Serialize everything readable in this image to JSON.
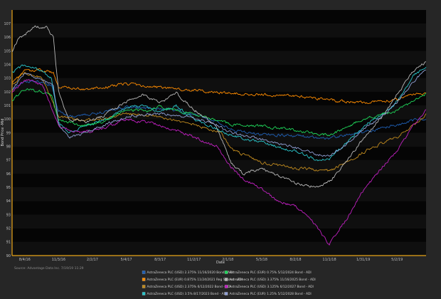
{
  "chart_data": {
    "type": "line",
    "xlabel": "Date",
    "ylabel": "Bond Price -Mid",
    "ylim": [
      90,
      108
    ],
    "yticks": [
      90,
      91,
      92,
      93,
      94,
      95,
      96,
      97,
      98,
      99,
      100,
      101,
      102,
      103,
      104,
      105,
      106,
      107
    ],
    "xticks": [
      "8/4/16",
      "11/3/16",
      "2/2/17",
      "5/4/17",
      "8/3/17",
      "11/2/17",
      "2/1/18",
      "5/3/18",
      "8/2/18",
      "11/1/18",
      "1/31/19",
      "5/2/19"
    ],
    "x_range": [
      "2016-07-01",
      "2019-07-19"
    ],
    "source": "Source: Advantage Data Inc. 7/19/19 11:29",
    "series": [
      {
        "name": "AstraZeneca PLC (USD) 2.375% 11/16/2020 Bond - ADI",
        "color": "#1f5fb4",
        "points": [
          [
            "2016-07-01",
            102.2
          ],
          [
            "2016-08-04",
            102.8
          ],
          [
            "2016-09-15",
            102.7
          ],
          [
            "2016-10-15",
            102.5
          ],
          [
            "2016-11-03",
            100.6
          ],
          [
            "2016-12-01",
            100.2
          ],
          [
            "2017-01-15",
            100.3
          ],
          [
            "2017-03-01",
            100.5
          ],
          [
            "2017-05-04",
            100.9
          ],
          [
            "2017-07-01",
            100.8
          ],
          [
            "2017-09-01",
            100.7
          ],
          [
            "2017-11-02",
            100.3
          ],
          [
            "2018-01-01",
            99.9
          ],
          [
            "2018-02-01",
            99.4
          ],
          [
            "2018-03-15",
            99.0
          ],
          [
            "2018-05-03",
            98.9
          ],
          [
            "2018-08-02",
            98.8
          ],
          [
            "2018-10-01",
            98.6
          ],
          [
            "2018-11-01",
            98.6
          ],
          [
            "2019-01-01",
            98.9
          ],
          [
            "2019-03-01",
            99.2
          ],
          [
            "2019-05-02",
            99.6
          ],
          [
            "2019-06-15",
            99.9
          ],
          [
            "2019-07-19",
            100.0
          ]
        ]
      },
      {
        "name": "AstraZeneca PLC (EUR) 0.875% 11/24/2021 Reg S Bond - ADI",
        "color": "#ff8c00",
        "points": [
          [
            "2016-07-01",
            102.6
          ],
          [
            "2016-08-04",
            103.5
          ],
          [
            "2016-09-15",
            103.6
          ],
          [
            "2016-10-20",
            103.4
          ],
          [
            "2016-11-03",
            102.4
          ],
          [
            "2017-01-01",
            102.2
          ],
          [
            "2017-03-01",
            102.3
          ],
          [
            "2017-05-04",
            102.6
          ],
          [
            "2017-08-03",
            102.3
          ],
          [
            "2017-11-02",
            102.1
          ],
          [
            "2018-02-01",
            101.9
          ],
          [
            "2018-05-03",
            101.8
          ],
          [
            "2018-08-02",
            101.7
          ],
          [
            "2018-11-01",
            101.4
          ],
          [
            "2019-01-15",
            101.2
          ],
          [
            "2019-03-01",
            101.3
          ],
          [
            "2019-05-02",
            101.4
          ],
          [
            "2019-06-15",
            101.9
          ],
          [
            "2019-07-19",
            101.9
          ]
        ]
      },
      {
        "name": "AstraZeneca PLC (USD) 2.375% 6/12/2022 Bond - ADI",
        "color": "#c08a1e",
        "points": [
          [
            "2016-07-01",
            102.5
          ],
          [
            "2016-08-04",
            103.4
          ],
          [
            "2016-09-20",
            103.0
          ],
          [
            "2016-11-03",
            100.2
          ],
          [
            "2017-01-01",
            99.9
          ],
          [
            "2017-03-01",
            100.0
          ],
          [
            "2017-05-04",
            100.4
          ],
          [
            "2017-08-03",
            100.2
          ],
          [
            "2017-11-02",
            99.6
          ],
          [
            "2018-01-15",
            99.0
          ],
          [
            "2018-02-10",
            97.8
          ],
          [
            "2018-05-03",
            96.8
          ],
          [
            "2018-08-02",
            96.4
          ],
          [
            "2018-10-01",
            96.3
          ],
          [
            "2018-11-01",
            96.2
          ],
          [
            "2018-12-15",
            96.8
          ],
          [
            "2019-02-15",
            97.8
          ],
          [
            "2019-05-02",
            98.7
          ],
          [
            "2019-06-15",
            99.5
          ],
          [
            "2019-07-19",
            100.4
          ]
        ]
      },
      {
        "name": "AstraZeneca PLC (USD) 3.5% 8/17/2023 Bond - ADI",
        "color": "#29c4c9",
        "points": [
          [
            "2016-07-01",
            103.4
          ],
          [
            "2016-08-04",
            104.0
          ],
          [
            "2016-09-15",
            103.6
          ],
          [
            "2016-10-15",
            103.0
          ],
          [
            "2016-11-03",
            99.8
          ],
          [
            "2016-12-01",
            99.0
          ],
          [
            "2017-01-15",
            99.5
          ],
          [
            "2017-03-01",
            99.9
          ],
          [
            "2017-05-04",
            100.8
          ],
          [
            "2017-06-15",
            101.0
          ],
          [
            "2017-08-03",
            100.5
          ],
          [
            "2017-09-15",
            101.0
          ],
          [
            "2017-11-02",
            100.0
          ],
          [
            "2018-01-01",
            99.3
          ],
          [
            "2018-02-10",
            98.8
          ],
          [
            "2018-04-01",
            98.5
          ],
          [
            "2018-05-03",
            98.3
          ],
          [
            "2018-08-02",
            97.6
          ],
          [
            "2018-10-01",
            97.0
          ],
          [
            "2018-11-01",
            97.1
          ],
          [
            "2018-12-15",
            98.2
          ],
          [
            "2019-02-01",
            99.5
          ],
          [
            "2019-04-01",
            100.5
          ],
          [
            "2019-05-02",
            101.3
          ],
          [
            "2019-06-15",
            103.2
          ],
          [
            "2019-07-19",
            103.8
          ]
        ]
      },
      {
        "name": "AstraZeneca PLC (EUR) 0.75% 5/12/2024 Bond - ADI",
        "color": "#1fd65a",
        "points": [
          [
            "2016-07-01",
            101.4
          ],
          [
            "2016-08-04",
            102.2
          ],
          [
            "2016-09-15",
            102.0
          ],
          [
            "2016-10-15",
            101.7
          ],
          [
            "2016-11-03",
            100.0
          ],
          [
            "2017-01-01",
            99.5
          ],
          [
            "2017-03-01",
            99.8
          ],
          [
            "2017-05-04",
            100.7
          ],
          [
            "2017-07-01",
            100.6
          ],
          [
            "2017-08-03",
            100.9
          ],
          [
            "2017-11-02",
            100.4
          ],
          [
            "2018-01-01",
            99.9
          ],
          [
            "2018-02-10",
            99.6
          ],
          [
            "2018-05-03",
            99.5
          ],
          [
            "2018-08-02",
            99.2
          ],
          [
            "2018-10-01",
            98.9
          ],
          [
            "2018-11-01",
            98.8
          ],
          [
            "2018-12-15",
            99.4
          ],
          [
            "2019-02-01",
            100.0
          ],
          [
            "2019-05-02",
            100.6
          ],
          [
            "2019-06-15",
            101.3
          ],
          [
            "2019-07-19",
            101.9
          ]
        ]
      },
      {
        "name": "AstraZeneca PLC (USD) 3.375% 11/16/2025 Bond - ADI",
        "color": "#b7b7b7",
        "points": [
          [
            "2016-07-01",
            105.0
          ],
          [
            "2016-07-20",
            106.0
          ],
          [
            "2016-08-04",
            106.2
          ],
          [
            "2016-09-01",
            106.8
          ],
          [
            "2016-10-01",
            106.7
          ],
          [
            "2016-10-20",
            106.0
          ],
          [
            "2016-11-03",
            102.0
          ],
          [
            "2016-12-01",
            100.0
          ],
          [
            "2017-01-15",
            99.8
          ],
          [
            "2017-03-01",
            100.2
          ],
          [
            "2017-05-04",
            101.3
          ],
          [
            "2017-06-15",
            101.8
          ],
          [
            "2017-08-03",
            101.2
          ],
          [
            "2017-09-15",
            101.9
          ],
          [
            "2017-11-02",
            100.7
          ],
          [
            "2018-01-01",
            99.5
          ],
          [
            "2018-02-10",
            96.8
          ],
          [
            "2018-03-15",
            96.0
          ],
          [
            "2018-05-03",
            96.4
          ],
          [
            "2018-08-02",
            95.3
          ],
          [
            "2018-10-01",
            95.0
          ],
          [
            "2018-11-01",
            95.4
          ],
          [
            "2018-12-15",
            96.8
          ],
          [
            "2019-02-01",
            98.6
          ],
          [
            "2019-04-01",
            100.5
          ],
          [
            "2019-05-02",
            101.8
          ],
          [
            "2019-06-15",
            103.5
          ],
          [
            "2019-07-19",
            104.2
          ]
        ]
      },
      {
        "name": "AstraZeneca PLC (USD) 3.125% 6/12/2027 Bond - ADI",
        "color": "#c020c0",
        "points": [
          [
            "2016-07-01",
            102.0
          ],
          [
            "2016-08-04",
            102.9
          ],
          [
            "2016-09-20",
            102.5
          ],
          [
            "2016-11-03",
            99.5
          ],
          [
            "2017-01-01",
            99.0
          ],
          [
            "2017-03-01",
            99.3
          ],
          [
            "2017-05-04",
            100.0
          ],
          [
            "2017-08-03",
            99.6
          ],
          [
            "2017-11-02",
            98.7
          ],
          [
            "2018-01-01",
            98.0
          ],
          [
            "2018-02-10",
            96.5
          ],
          [
            "2018-03-15",
            95.6
          ],
          [
            "2018-05-03",
            94.9
          ],
          [
            "2018-06-15",
            94.0
          ],
          [
            "2018-08-02",
            93.6
          ],
          [
            "2018-09-15",
            92.6
          ],
          [
            "2018-10-15",
            91.4
          ],
          [
            "2018-11-01",
            90.8
          ],
          [
            "2018-11-20",
            91.6
          ],
          [
            "2018-12-20",
            92.8
          ],
          [
            "2019-02-01",
            94.8
          ],
          [
            "2019-03-15",
            96.2
          ],
          [
            "2019-05-02",
            97.7
          ],
          [
            "2019-06-15",
            99.5
          ],
          [
            "2019-07-19",
            100.7
          ]
        ]
      },
      {
        "name": "AstraZeneca PLC (EUR) 1.25% 5/12/2028 Bond - ADI",
        "color": "#8f9fd4",
        "points": [
          [
            "2016-07-01",
            102.2
          ],
          [
            "2016-08-04",
            103.3
          ],
          [
            "2016-09-15",
            103.0
          ],
          [
            "2016-10-20",
            102.4
          ],
          [
            "2016-11-03",
            99.6
          ],
          [
            "2016-12-01",
            98.6
          ],
          [
            "2017-01-15",
            99.0
          ],
          [
            "2017-03-01",
            99.5
          ],
          [
            "2017-05-04",
            100.2
          ],
          [
            "2017-08-03",
            100.4
          ],
          [
            "2017-11-02",
            100.1
          ],
          [
            "2018-01-01",
            99.6
          ],
          [
            "2018-02-10",
            99.0
          ],
          [
            "2018-05-03",
            98.5
          ],
          [
            "2018-08-02",
            97.9
          ],
          [
            "2018-10-01",
            97.4
          ],
          [
            "2018-11-01",
            97.3
          ],
          [
            "2018-12-15",
            98.1
          ],
          [
            "2019-02-01",
            99.2
          ],
          [
            "2019-04-01",
            100.4
          ],
          [
            "2019-05-02",
            101.2
          ],
          [
            "2019-06-15",
            102.8
          ],
          [
            "2019-07-19",
            103.6
          ]
        ]
      }
    ],
    "legend_position": "bottom-center",
    "grid": "alternating horizontal bands"
  }
}
